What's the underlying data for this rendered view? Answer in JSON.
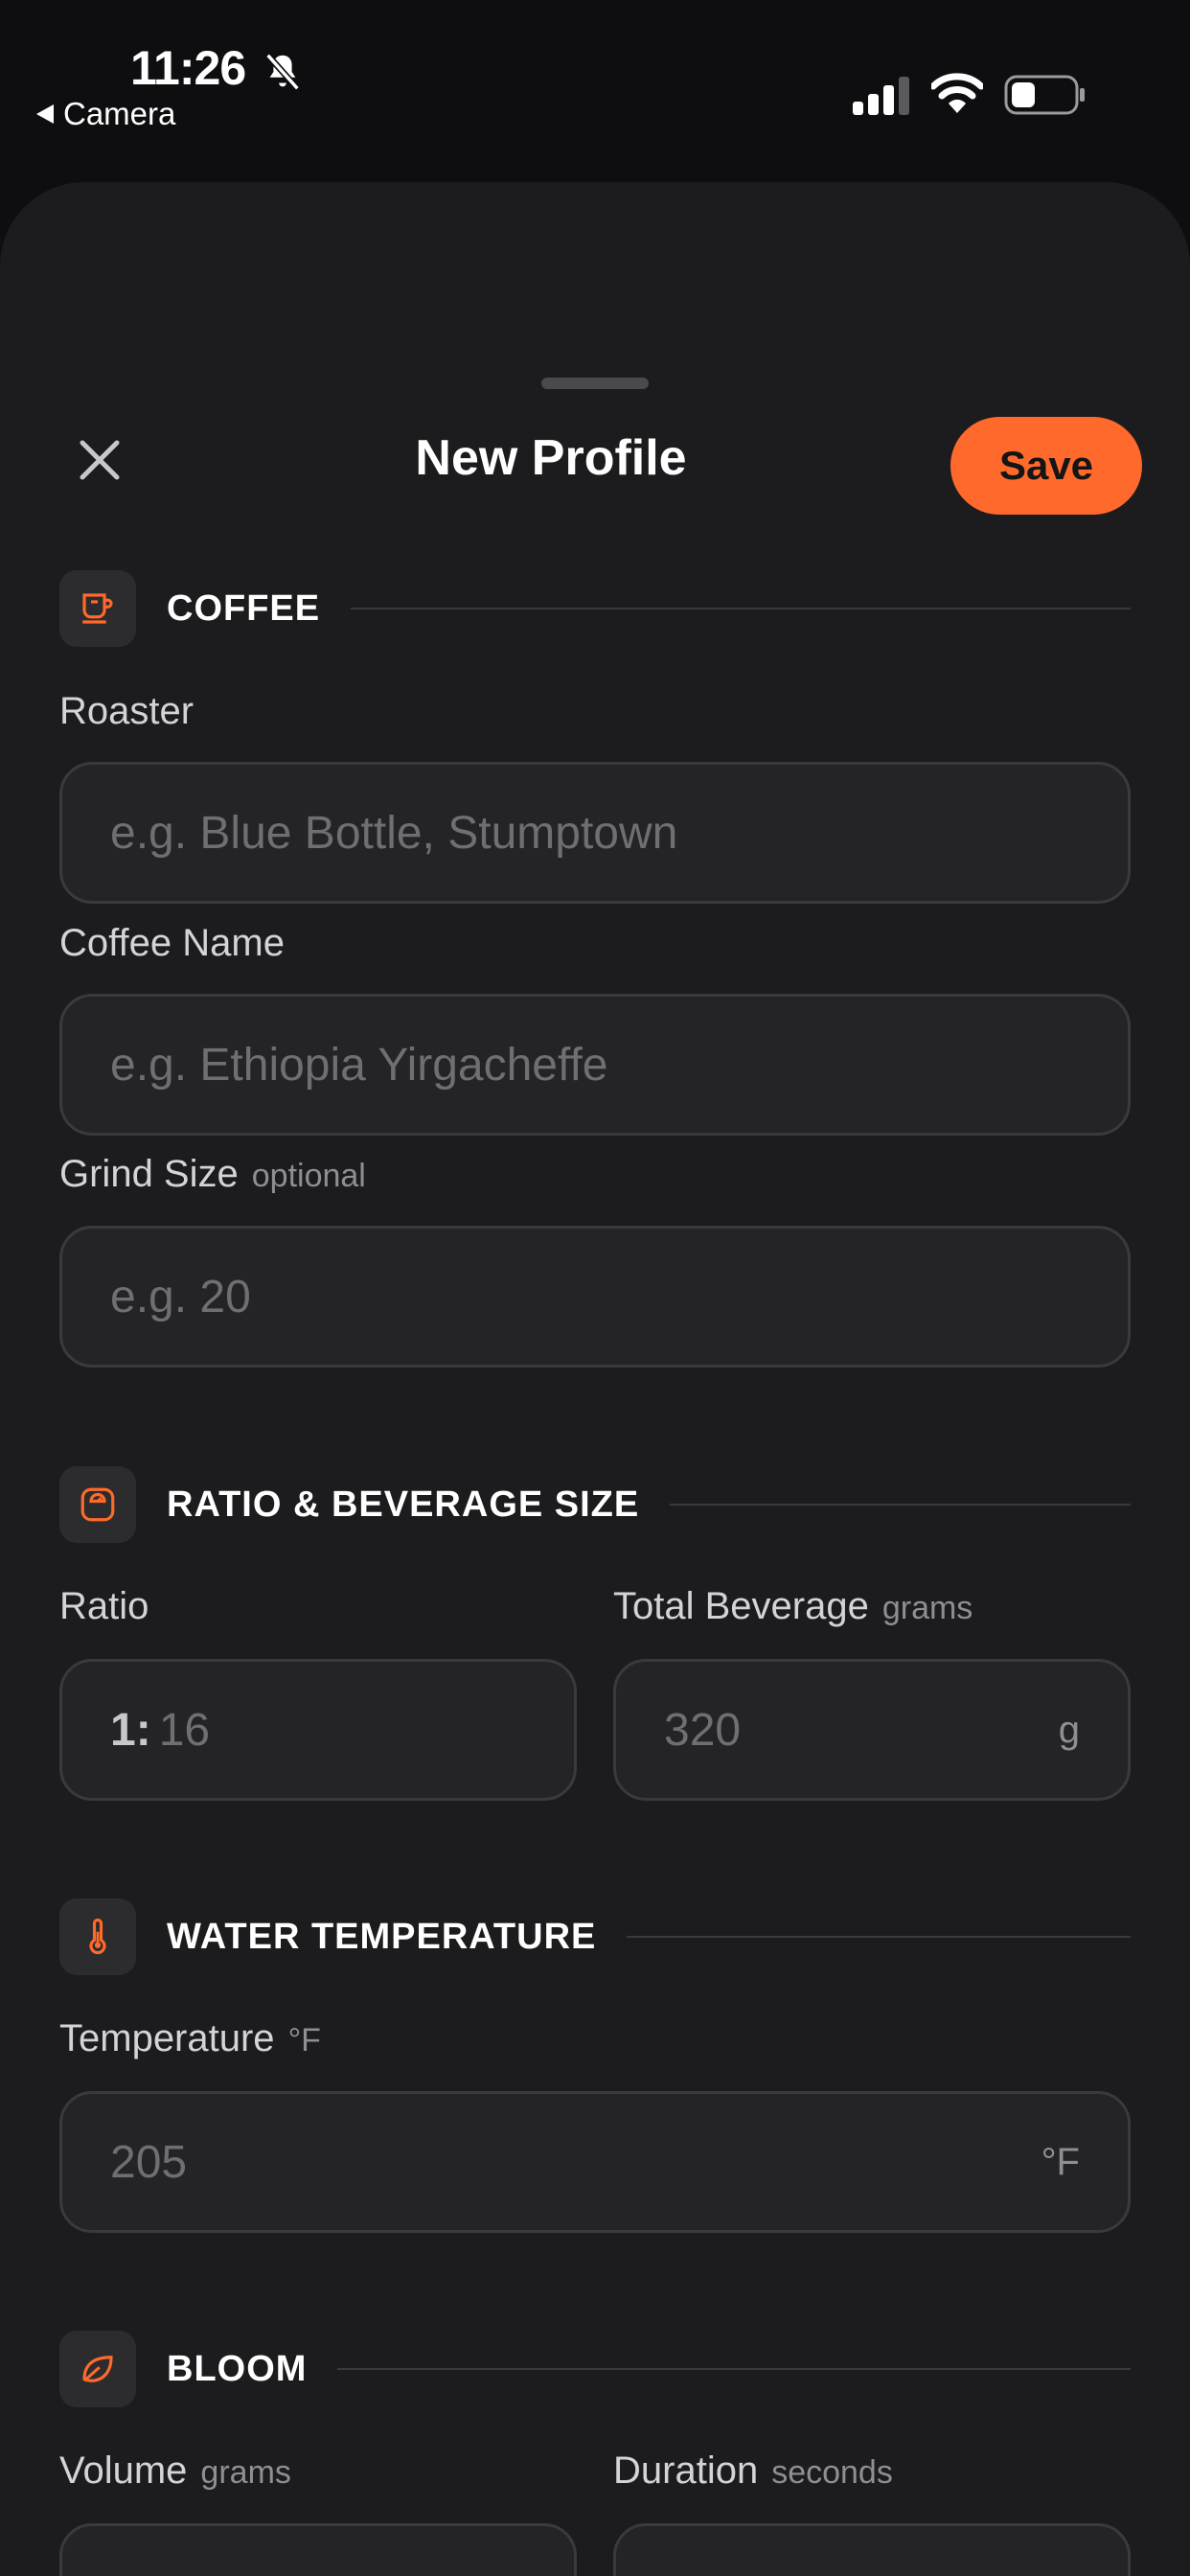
{
  "status_bar": {
    "time": "11:26",
    "back_label": "Camera"
  },
  "header": {
    "title": "New Profile",
    "save_label": "Save"
  },
  "sections": {
    "coffee": {
      "title": "COFFEE",
      "icon": "coffee-cup-icon",
      "roaster_label": "Roaster",
      "roaster_placeholder": "e.g. Blue Bottle, Stumptown",
      "coffee_name_label": "Coffee Name",
      "coffee_name_placeholder": "e.g. Ethiopia Yirgacheffe",
      "grind_label": "Grind Size",
      "grind_hint": "optional",
      "grind_placeholder": "e.g. 20"
    },
    "ratio": {
      "title": "RATIO & BEVERAGE SIZE",
      "icon": "scale-icon",
      "ratio_label": "Ratio",
      "ratio_prefix": "1:",
      "ratio_value": "16",
      "beverage_label": "Total Beverage",
      "beverage_hint": "grams",
      "beverage_value": "320",
      "beverage_unit": "g"
    },
    "water": {
      "title": "WATER TEMPERATURE",
      "icon": "thermometer-icon",
      "temp_label": "Temperature",
      "temp_hint": "°F",
      "temp_value": "205",
      "temp_unit": "°F"
    },
    "bloom": {
      "title": "BLOOM",
      "icon": "leaf-icon",
      "volume_label": "Volume",
      "volume_hint": "grams",
      "duration_label": "Duration",
      "duration_hint": "seconds"
    }
  },
  "colors": {
    "accent": "#ff6a2c",
    "sheet_bg": "#1c1c1e",
    "field_bg": "#242426"
  }
}
